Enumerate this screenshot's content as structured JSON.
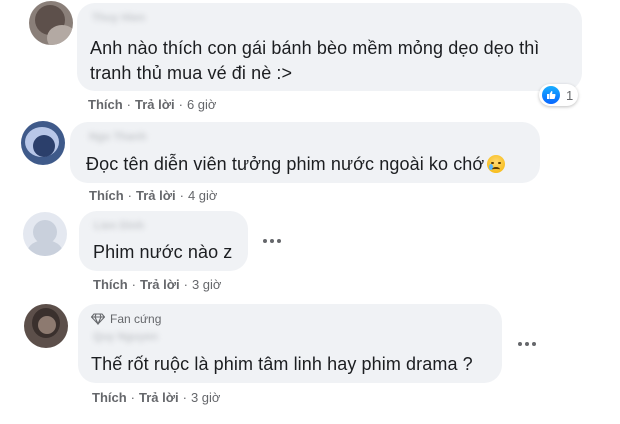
{
  "comments": [
    {
      "author": "Thuy Hien",
      "lines": [
        "Anh nào thích con gái bánh bèo mềm mỏng dẹo dẹo thì",
        "tranh thủ mua vé đi nè :>"
      ],
      "like": "Thích",
      "reply": "Trả lời",
      "time": "6 giờ",
      "reaction_count": "1"
    },
    {
      "author": "Ngo Thanh",
      "lines": [
        "Đọc tên diễn viên tưởng phim nước ngoài ko chớ"
      ],
      "emoji": "sad-face-with-tear-emoji",
      "like": "Thích",
      "reply": "Trả lời",
      "time": "4 giờ"
    },
    {
      "author": "Lien Dinh",
      "lines": [
        "Phim nước nào z"
      ],
      "like": "Thích",
      "reply": "Trả lời",
      "time": "3 giờ"
    },
    {
      "badge": "Fan cứng",
      "author": "Quy Nguyen",
      "lines": [
        "Thế rốt ruộc là phim tâm linh hay phim drama ?"
      ],
      "like": "Thích",
      "reply": "Trả lời",
      "time": "3 giờ"
    }
  ],
  "separator": "·",
  "colors": {
    "bubble": "#f0f2f5",
    "text": "#1c1e21",
    "secondary": "#65676b",
    "like_blue": "#0866ff"
  }
}
